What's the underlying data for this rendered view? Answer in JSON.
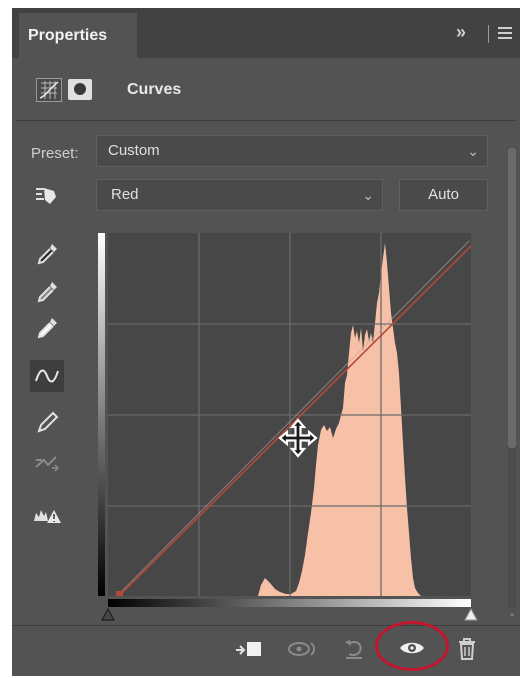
{
  "panel": {
    "tab_label": "Properties",
    "header_title": "Curves",
    "header_icons": [
      "curves-adjustment-icon",
      "layer-mask-icon"
    ]
  },
  "preset": {
    "label": "Preset:",
    "value": "Custom"
  },
  "channel": {
    "value": "Red",
    "auto_label": "Auto"
  },
  "tools": [
    "on-image-adjust-icon",
    "black-point-eyedropper-icon",
    "gray-point-eyedropper-icon",
    "white-point-eyedropper-icon",
    "curve-point-tool-icon",
    "pencil-draw-icon",
    "smooth-curve-icon",
    "clipping-warning-icon"
  ],
  "bottom_bar": [
    "clip-to-layer-icon",
    "view-previous-state-icon",
    "reset-adjustment-icon",
    "toggle-visibility-icon",
    "delete-adjustment-icon"
  ],
  "colors": {
    "panel_bg": "#535353",
    "tab_bar_bg": "#424242",
    "graph_bg": "#474747",
    "histogram": "#f7c1a7",
    "curve_line": "#b5483a",
    "highlight_circle": "#c0172f"
  }
}
